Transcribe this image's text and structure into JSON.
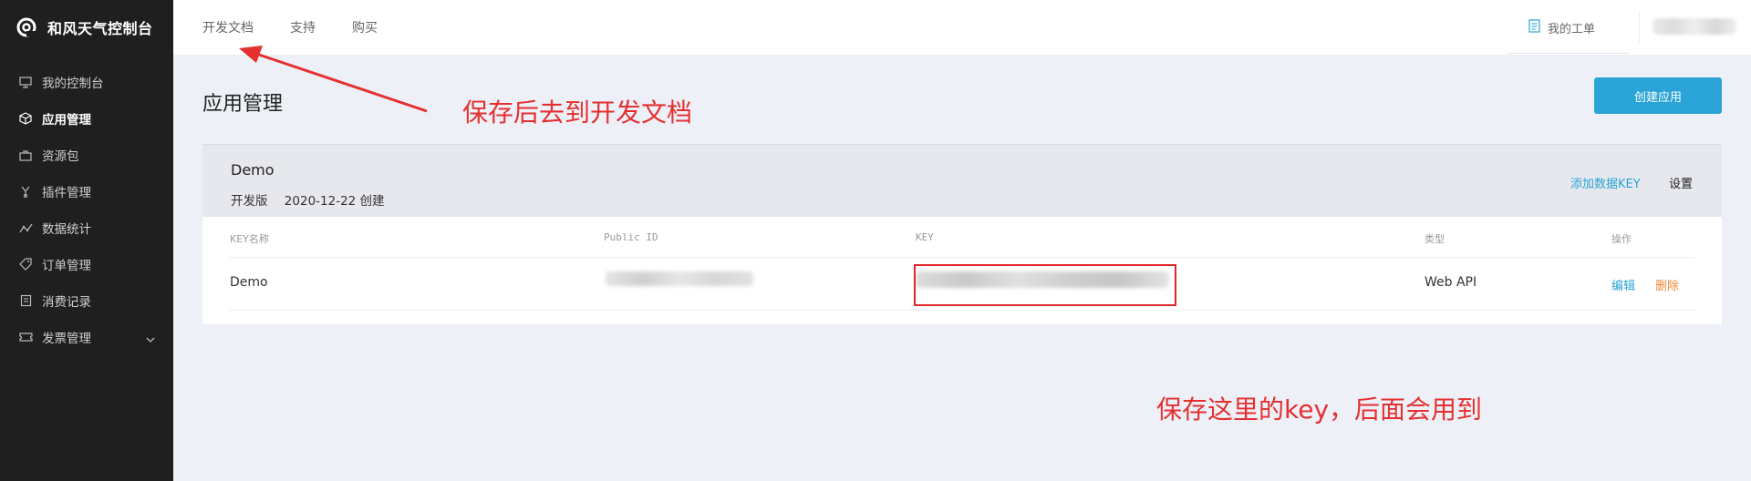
{
  "app": {
    "title": "和风天气控制台"
  },
  "sidebar": {
    "items": [
      {
        "label": "我的控制台",
        "icon": "monitor-icon"
      },
      {
        "label": "应用管理",
        "icon": "cube-icon",
        "active": true
      },
      {
        "label": "资源包",
        "icon": "briefcase-icon"
      },
      {
        "label": "插件管理",
        "icon": "plugin-icon"
      },
      {
        "label": "数据统计",
        "icon": "stats-icon"
      },
      {
        "label": "订单管理",
        "icon": "tag-icon"
      },
      {
        "label": "消费记录",
        "icon": "receipt-icon"
      },
      {
        "label": "发票管理",
        "icon": "ticket-icon",
        "expandable": true
      }
    ]
  },
  "topnav": {
    "items": [
      "开发文档",
      "支持",
      "购买"
    ],
    "tickets_label": "我的工单"
  },
  "page": {
    "title": "应用管理",
    "create_button": "创建应用"
  },
  "app_card": {
    "name": "Demo",
    "edition": "开发版",
    "created": "2020-12-22 创建",
    "add_key_label": "添加数据KEY",
    "settings_label": "设置",
    "columns": [
      "KEY名称",
      "Public ID",
      "KEY",
      "类型",
      "操作"
    ],
    "rows": [
      {
        "name": "Demo",
        "type": "Web API",
        "edit": "编辑",
        "delete": "删除"
      }
    ]
  },
  "annotations": {
    "docs_note": "保存后去到开发文档",
    "key_note": "保存这里的key，后面会用到"
  },
  "colors": {
    "accent": "#2aa4d6",
    "sidebar_bg": "#1f1f1f",
    "annotation": "#e53030",
    "delete": "#f0883a"
  }
}
